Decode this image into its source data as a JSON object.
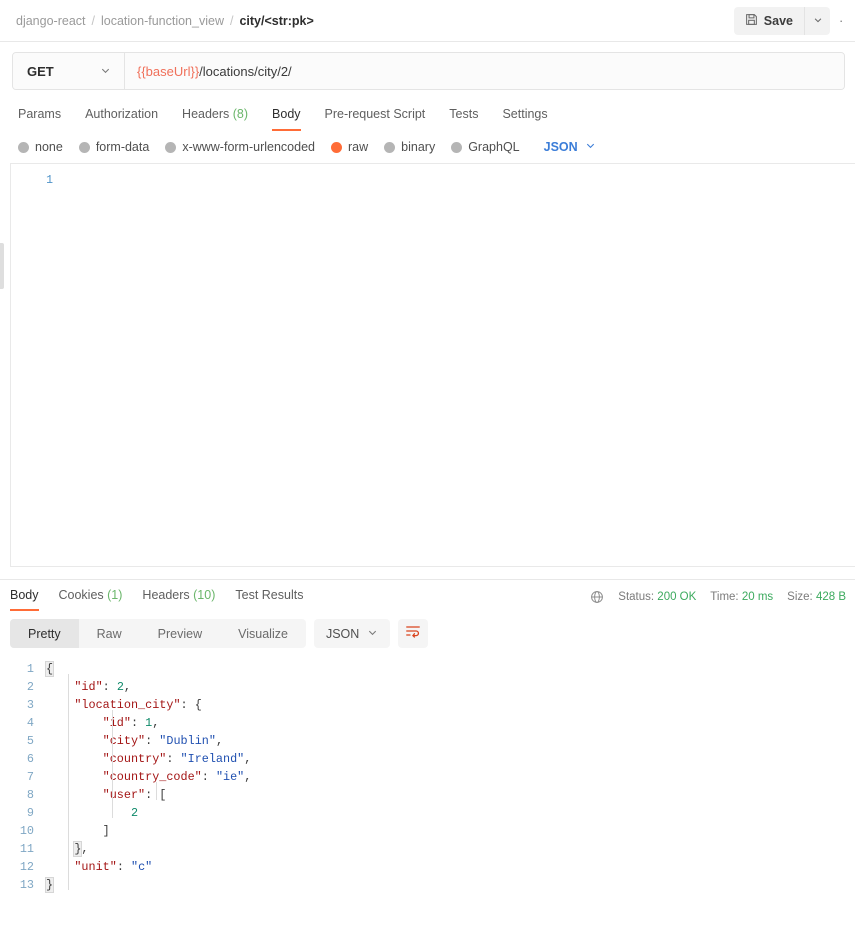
{
  "topbar": {
    "breadcrumb": [
      {
        "label": "django-react",
        "active": false
      },
      {
        "label": "location-function_view",
        "active": false
      },
      {
        "label": "city/<str:pk>",
        "active": true
      }
    ],
    "separator": "/",
    "save_label": "Save",
    "save_icon": "floppy-disk-icon",
    "save_caret_icon": "chevron-down-icon",
    "more_label": "···"
  },
  "request": {
    "method": "GET",
    "method_caret_icon": "chevron-down-icon",
    "url_variable": "{{baseUrl}}",
    "url_path": "/locations/city/2/",
    "tabs": [
      {
        "label": "Params",
        "count": "",
        "active": false
      },
      {
        "label": "Authorization",
        "count": "",
        "active": false
      },
      {
        "label": "Headers",
        "count": "(8)",
        "active": false
      },
      {
        "label": "Body",
        "count": "",
        "active": true
      },
      {
        "label": "Pre-request Script",
        "count": "",
        "active": false
      },
      {
        "label": "Tests",
        "count": "",
        "active": false
      },
      {
        "label": "Settings",
        "count": "",
        "active": false
      }
    ],
    "body_modes": [
      {
        "label": "none",
        "selected": false
      },
      {
        "label": "form-data",
        "selected": false
      },
      {
        "label": "x-www-form-urlencoded",
        "selected": false
      },
      {
        "label": "raw",
        "selected": true
      },
      {
        "label": "binary",
        "selected": false
      },
      {
        "label": "GraphQL",
        "selected": false
      }
    ],
    "body_format": "JSON",
    "body_format_caret_icon": "chevron-down-icon",
    "editor_line_number": "1",
    "editor_content": ""
  },
  "response": {
    "tabs": [
      {
        "label": "Body",
        "count": "",
        "active": true
      },
      {
        "label": "Cookies",
        "count": "(1)",
        "active": false
      },
      {
        "label": "Headers",
        "count": "(10)",
        "active": false
      },
      {
        "label": "Test Results",
        "count": "",
        "active": false
      }
    ],
    "globe_icon": "globe-icon",
    "status_label": "Status:",
    "status_value": "200 OK",
    "time_label": "Time:",
    "time_value": "20 ms",
    "size_label": "Size:",
    "size_value": "428 B",
    "view_modes": [
      {
        "label": "Pretty",
        "active": true
      },
      {
        "label": "Raw",
        "active": false
      },
      {
        "label": "Preview",
        "active": false
      },
      {
        "label": "Visualize",
        "active": false
      }
    ],
    "format": "JSON",
    "format_caret_icon": "chevron-down-icon",
    "wrap_icon": "word-wrap-icon",
    "body_lines": [
      {
        "no": "1",
        "tokens": [
          {
            "t": "{",
            "c": "p brace-hl"
          }
        ]
      },
      {
        "no": "2",
        "tokens": [
          {
            "t": "    ",
            "c": "p"
          },
          {
            "t": "\"id\"",
            "c": "k"
          },
          {
            "t": ": ",
            "c": "p"
          },
          {
            "t": "2",
            "c": "n"
          },
          {
            "t": ",",
            "c": "p"
          }
        ]
      },
      {
        "no": "3",
        "tokens": [
          {
            "t": "    ",
            "c": "p"
          },
          {
            "t": "\"location_city\"",
            "c": "k"
          },
          {
            "t": ": {",
            "c": "p"
          }
        ]
      },
      {
        "no": "4",
        "tokens": [
          {
            "t": "        ",
            "c": "p"
          },
          {
            "t": "\"id\"",
            "c": "k"
          },
          {
            "t": ": ",
            "c": "p"
          },
          {
            "t": "1",
            "c": "n"
          },
          {
            "t": ",",
            "c": "p"
          }
        ]
      },
      {
        "no": "5",
        "tokens": [
          {
            "t": "        ",
            "c": "p"
          },
          {
            "t": "\"city\"",
            "c": "k"
          },
          {
            "t": ": ",
            "c": "p"
          },
          {
            "t": "\"Dublin\"",
            "c": "s"
          },
          {
            "t": ",",
            "c": "p"
          }
        ]
      },
      {
        "no": "6",
        "tokens": [
          {
            "t": "        ",
            "c": "p"
          },
          {
            "t": "\"country\"",
            "c": "k"
          },
          {
            "t": ": ",
            "c": "p"
          },
          {
            "t": "\"Ireland\"",
            "c": "s"
          },
          {
            "t": ",",
            "c": "p"
          }
        ]
      },
      {
        "no": "7",
        "tokens": [
          {
            "t": "        ",
            "c": "p"
          },
          {
            "t": "\"country_code\"",
            "c": "k"
          },
          {
            "t": ": ",
            "c": "p"
          },
          {
            "t": "\"ie\"",
            "c": "s"
          },
          {
            "t": ",",
            "c": "p"
          }
        ]
      },
      {
        "no": "8",
        "tokens": [
          {
            "t": "        ",
            "c": "p"
          },
          {
            "t": "\"user\"",
            "c": "k"
          },
          {
            "t": ": [",
            "c": "p"
          }
        ]
      },
      {
        "no": "9",
        "tokens": [
          {
            "t": "            ",
            "c": "p"
          },
          {
            "t": "2",
            "c": "n"
          }
        ]
      },
      {
        "no": "10",
        "tokens": [
          {
            "t": "        ]",
            "c": "p"
          }
        ]
      },
      {
        "no": "11",
        "tokens": [
          {
            "t": "    ",
            "c": "p"
          },
          {
            "t": "}",
            "c": "p brace-hl"
          },
          {
            "t": ",",
            "c": "p"
          }
        ]
      },
      {
        "no": "12",
        "tokens": [
          {
            "t": "    ",
            "c": "p"
          },
          {
            "t": "\"unit\"",
            "c": "k"
          },
          {
            "t": ": ",
            "c": "p"
          },
          {
            "t": "\"c\"",
            "c": "s"
          }
        ]
      },
      {
        "no": "13",
        "tokens": [
          {
            "t": "}",
            "c": "p brace-hl"
          }
        ]
      }
    ]
  },
  "colors": {
    "accent": "#ff6c37",
    "success": "#3caa5e",
    "variable": "#f0705a",
    "link": "#3b7dd8"
  }
}
